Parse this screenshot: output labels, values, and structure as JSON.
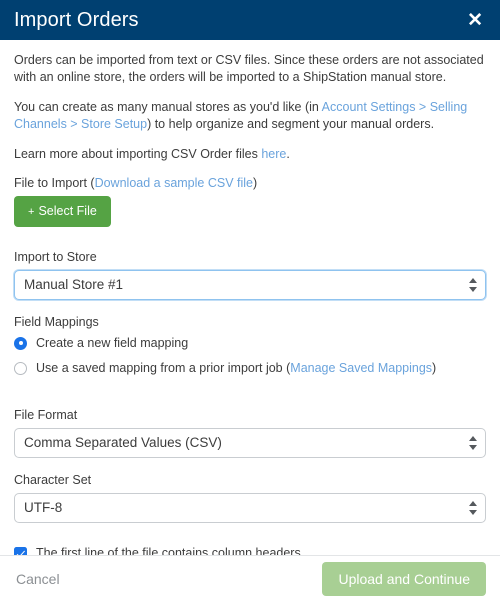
{
  "dialog": {
    "title": "Import Orders",
    "close_icon": "close-icon",
    "header_color": "#004071"
  },
  "intro": {
    "paragraph1": "Orders can be imported from text or CSV files. Since these orders are not associated with an online store, the orders will be imported to a ShipStation manual store.",
    "paragraph2_part1": "You can create as many manual stores as you'd like (in ",
    "paragraph2_link": "Account Settings > Selling Channels > Store Setup",
    "paragraph2_part2": ") to help organize and segment your manual orders.",
    "paragraph3_part1": "Learn more about importing CSV Order files ",
    "paragraph3_link": "here",
    "paragraph3_part2": "."
  },
  "file_to_import": {
    "label_part1": "File to Import (",
    "label_link": "Download a sample CSV file",
    "label_part2": ")",
    "select_file_button": "Select File",
    "select_file_plus": "+",
    "button_color": "#55a344"
  },
  "import_to_store": {
    "label": "Import to Store",
    "value": "Manual Store #1",
    "options": [
      "Manual Store #1"
    ]
  },
  "field_mappings": {
    "label": "Field Mappings",
    "option_new": "Create a new field mapping",
    "option_saved_part1": "Use a saved mapping from a prior import job (",
    "option_saved_link": "Manage Saved Mappings",
    "option_saved_part2": ")",
    "selected": "new"
  },
  "file_format": {
    "label": "File Format",
    "value": "Comma Separated Values (CSV)",
    "options": [
      "Comma Separated Values (CSV)"
    ]
  },
  "character_set": {
    "label": "Character Set",
    "value": "UTF-8",
    "options": [
      "UTF-8"
    ]
  },
  "header_row": {
    "label": "The first line of the file contains column headers",
    "checked": true
  },
  "footer": {
    "cancel_label": "Cancel",
    "submit_label": "Upload and Continue",
    "submit_disabled": true,
    "submit_color": "#a8cf94"
  },
  "colors": {
    "link": "#6aa3dc",
    "accent_blue": "#1a73e8",
    "header_blue": "#004071",
    "green": "#55a344"
  }
}
